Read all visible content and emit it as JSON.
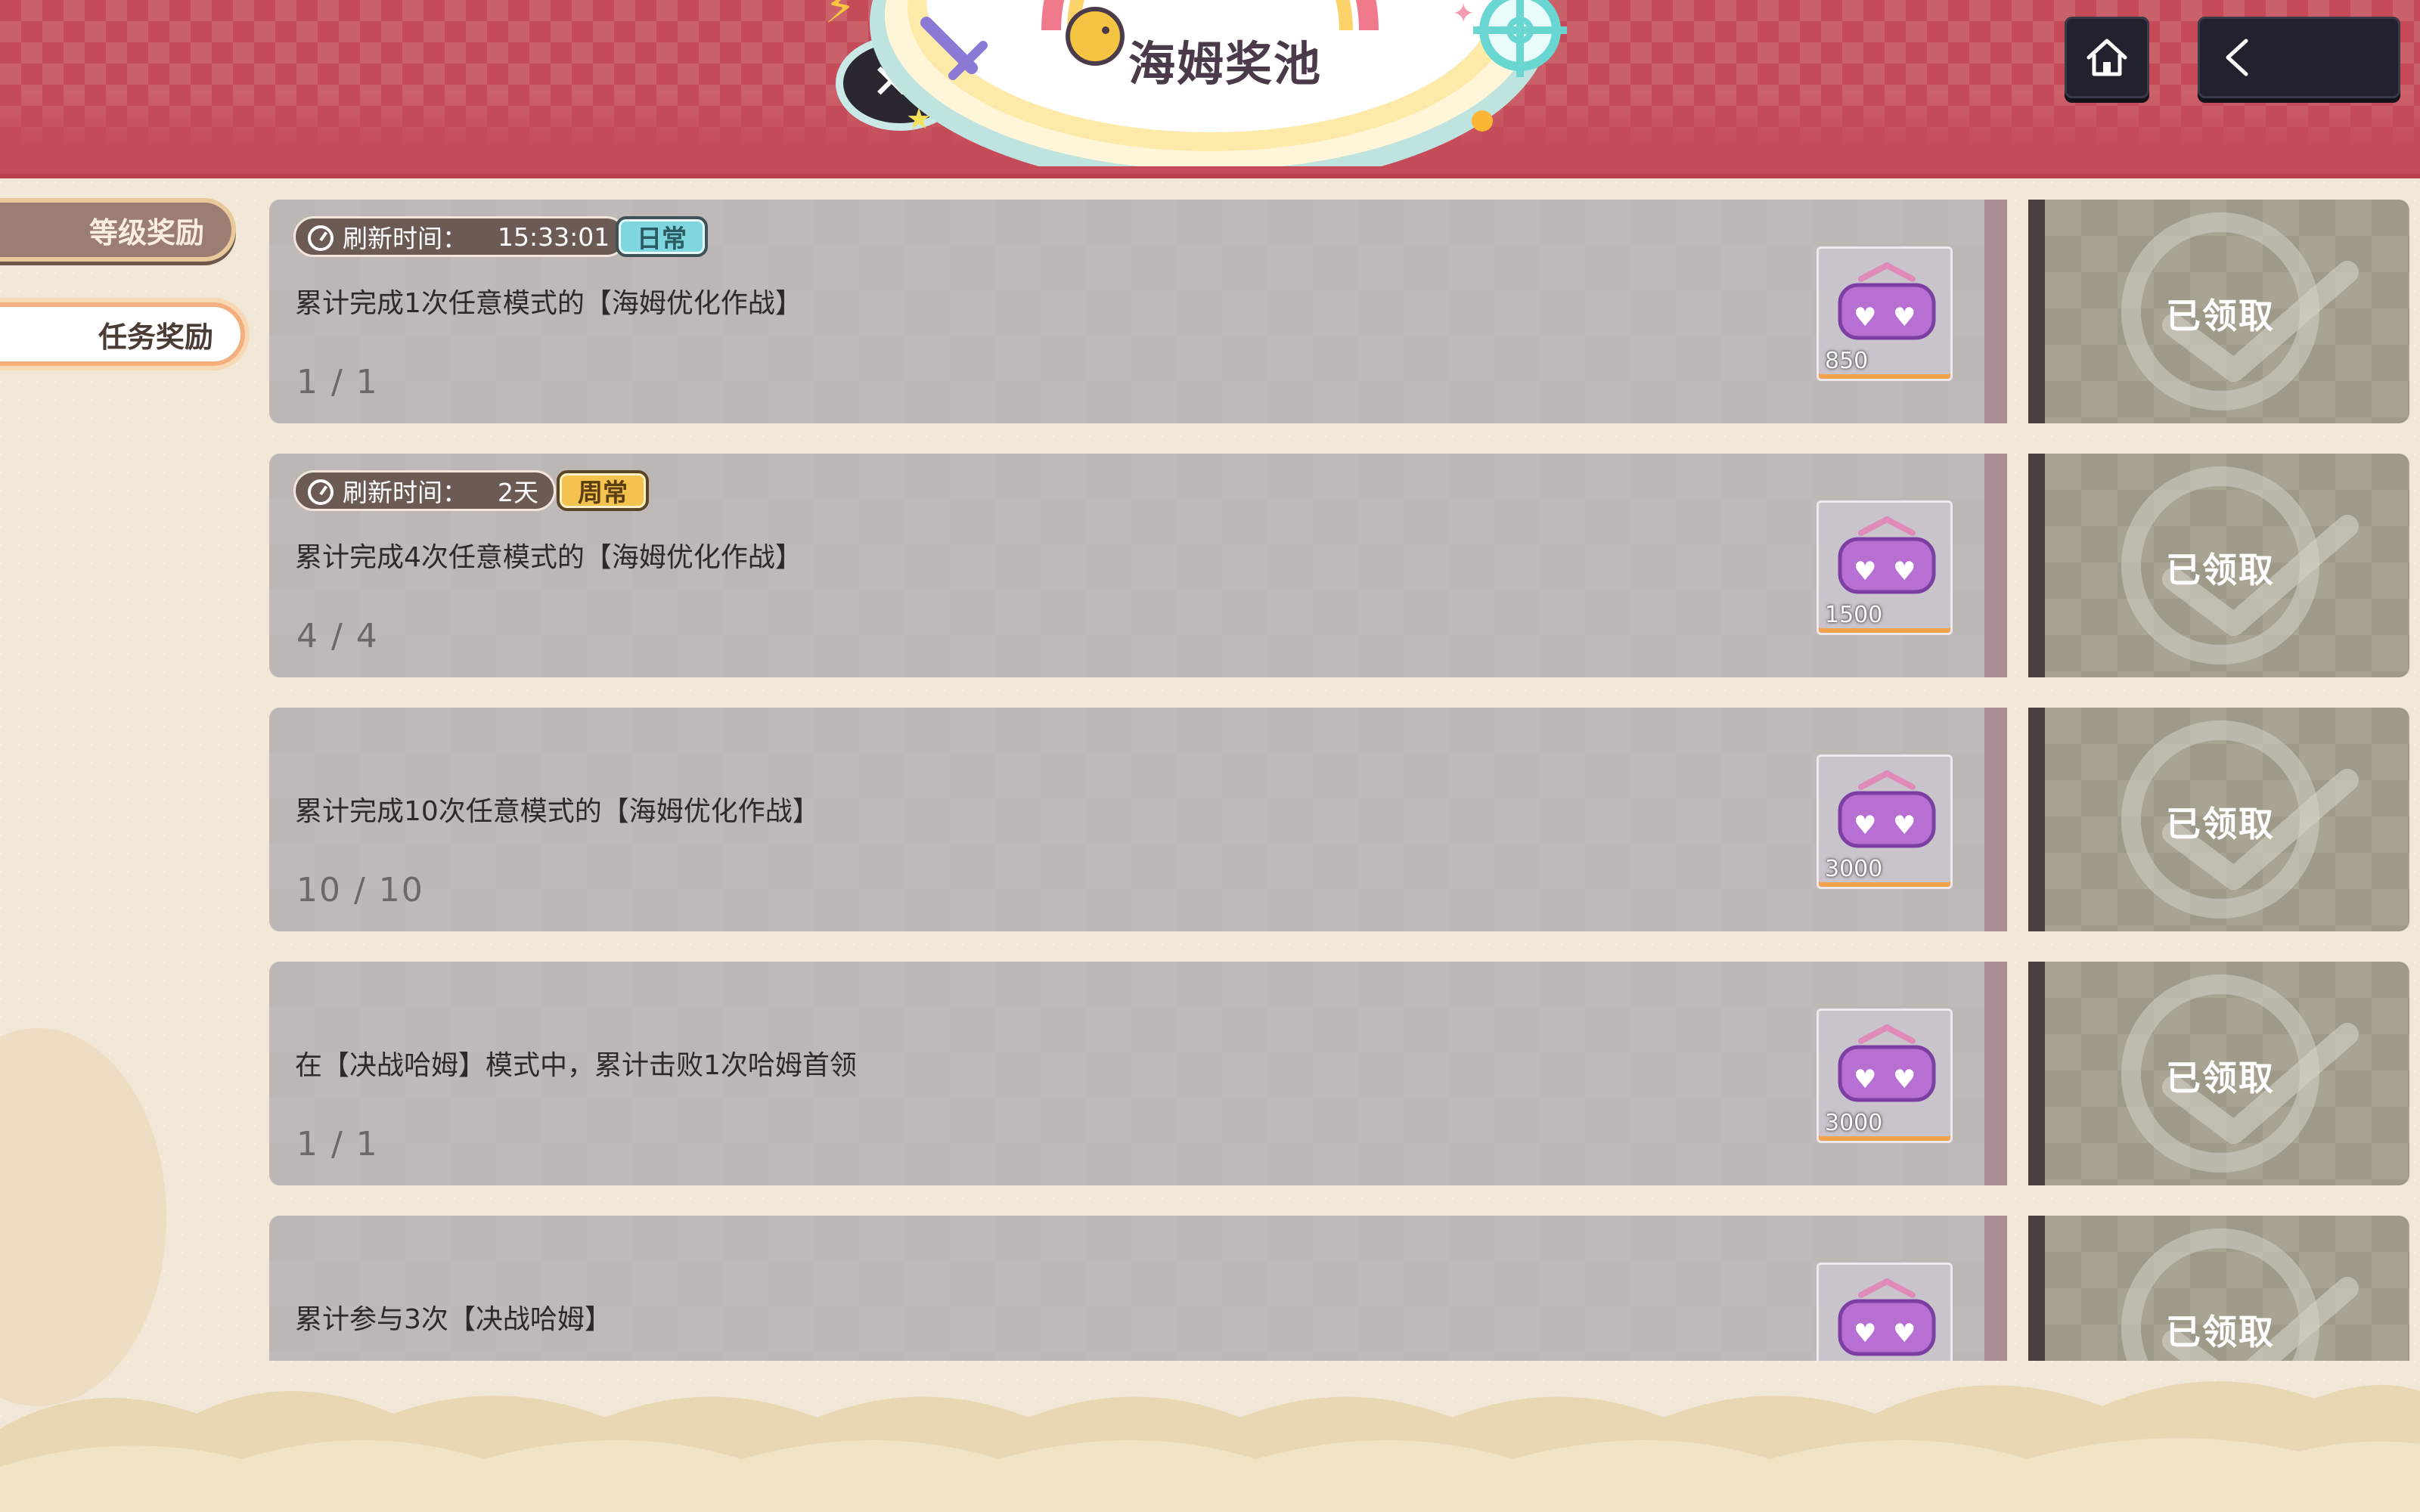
{
  "header": {
    "title": "海姆奖池"
  },
  "nav": {
    "home_icon": "home-icon",
    "back_icon": "back-arrow-icon"
  },
  "side_tabs": [
    {
      "label": "等级奖励",
      "active": false
    },
    {
      "label": "任务奖励",
      "active": true
    }
  ],
  "tasks": [
    {
      "refresh_label": "刷新时间：",
      "refresh_value": "15:33:01",
      "type_badge": "日常",
      "description": "累计完成1次任意模式的【海姆优化作战】",
      "progress": "1 / 1",
      "reward_count": "850",
      "status": "已领取"
    },
    {
      "refresh_label": "刷新时间：",
      "refresh_value": "2天",
      "type_badge": "周常",
      "description": "累计完成4次任意模式的【海姆优化作战】",
      "progress": "4 / 4",
      "reward_count": "1500",
      "status": "已领取"
    },
    {
      "description": "累计完成10次任意模式的【海姆优化作战】",
      "progress": "10 / 10",
      "reward_count": "3000",
      "status": "已领取"
    },
    {
      "description": "在【决战哈姆】模式中，累计击败1次哈姆首领",
      "progress": "1 / 1",
      "reward_count": "3000",
      "status": "已领取"
    },
    {
      "description": "累计参与3次【决战哈姆】",
      "status": "已领取"
    }
  ],
  "colors": {
    "header_red": "#c44b57",
    "card_grey": "#bcb6b5",
    "claimed_panel": "#a8a392",
    "daily_badge": "#7fd6df",
    "weekly_badge": "#f4c34f"
  }
}
